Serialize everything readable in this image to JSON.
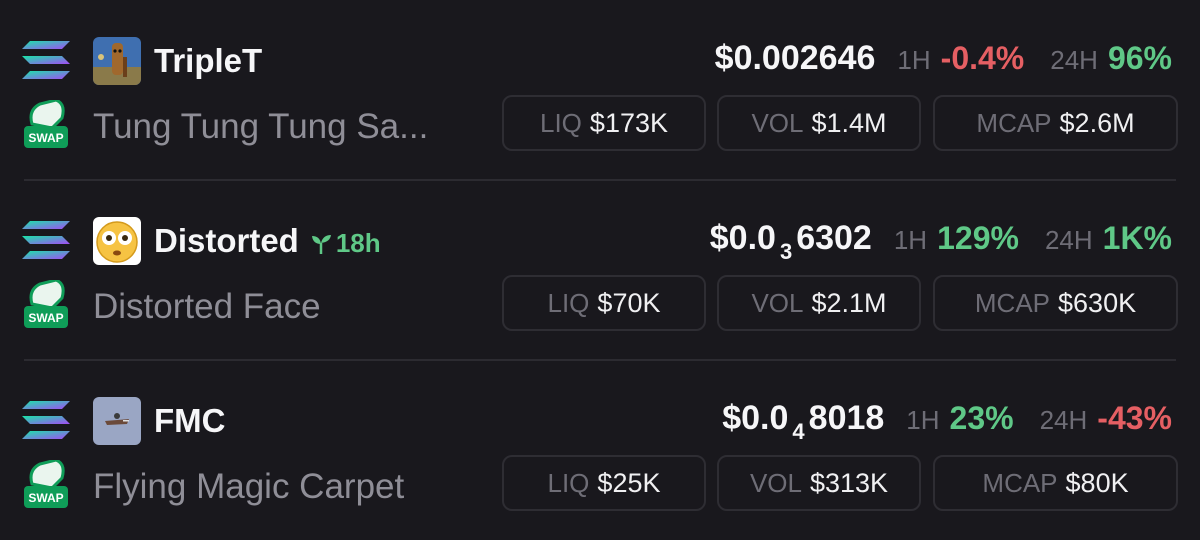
{
  "labels": {
    "h1": "1H",
    "h24": "24H",
    "liq": "LIQ",
    "vol": "VOL",
    "mcap": "MCAP"
  },
  "colors": {
    "positive": "#5fc887",
    "negative": "#e55f63",
    "background": "#19181d"
  },
  "icons": {
    "chain": "solana-icon",
    "dex": "swap-icon",
    "age": "sprout-icon"
  },
  "tokens": [
    {
      "symbol": "TripleT",
      "name": "Tung Tung Tung Sa...",
      "avatar": "triplet-avatar-icon",
      "age": "",
      "price_prefix": "$0.002646",
      "price_zeros": "",
      "price_rest": "",
      "change_1h": "-0.4%",
      "change_1h_dir": "neg",
      "change_24h": "96%",
      "change_24h_dir": "pos",
      "liq": "$173K",
      "vol": "$1.4M",
      "mcap": "$2.6M"
    },
    {
      "symbol": "Distorted",
      "name": "Distorted Face",
      "avatar": "distorted-face-avatar-icon",
      "age": "18h",
      "price_prefix": "$0.0",
      "price_zeros": "3",
      "price_rest": "6302",
      "change_1h": "129%",
      "change_1h_dir": "pos",
      "change_24h": "1K%",
      "change_24h_dir": "pos",
      "liq": "$70K",
      "vol": "$2.1M",
      "mcap": "$630K"
    },
    {
      "symbol": "FMC",
      "name": "Flying Magic Carpet",
      "avatar": "fmc-avatar-icon",
      "age": "",
      "price_prefix": "$0.0",
      "price_zeros": "4",
      "price_rest": "8018",
      "change_1h": "23%",
      "change_1h_dir": "pos",
      "change_24h": "-43%",
      "change_24h_dir": "neg",
      "liq": "$25K",
      "vol": "$313K",
      "mcap": "$80K"
    }
  ]
}
